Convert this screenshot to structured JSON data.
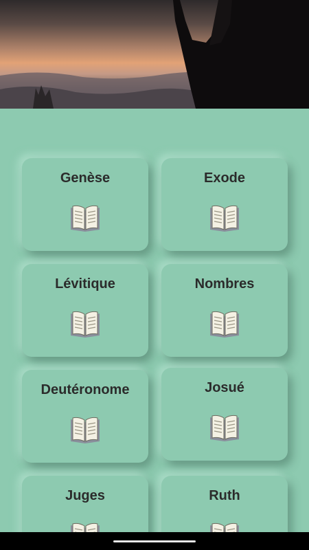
{
  "books": [
    {
      "title": "Genèse",
      "icon": "open-book-icon"
    },
    {
      "title": "Exode",
      "icon": "open-book-icon"
    },
    {
      "title": "Lévitique",
      "icon": "open-book-icon"
    },
    {
      "title": "Nombres",
      "icon": "open-book-icon"
    },
    {
      "title": "Deutéronome",
      "icon": "open-book-icon"
    },
    {
      "title": "Josué",
      "icon": "open-book-icon"
    },
    {
      "title": "Juges",
      "icon": "open-book-icon"
    },
    {
      "title": "Ruth",
      "icon": "open-book-icon"
    }
  ],
  "colors": {
    "background": "#8dcab0",
    "text": "#2b2b2b"
  }
}
